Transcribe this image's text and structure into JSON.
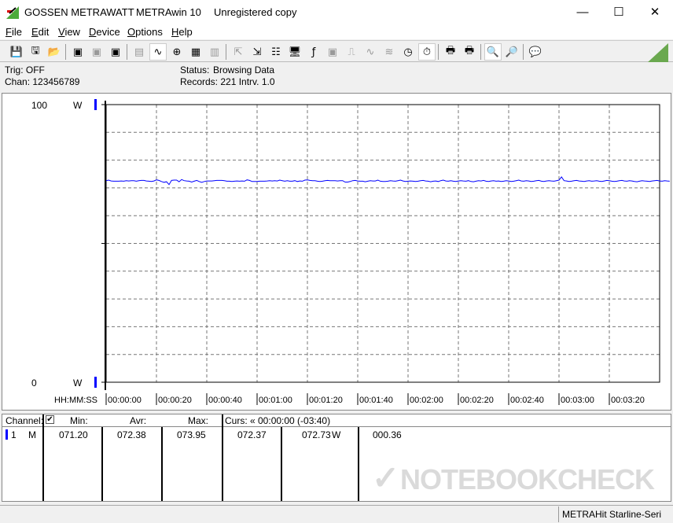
{
  "window": {
    "brand": "GOSSEN METRAWATT",
    "app": "METRAwin 10",
    "license": "Unregistered copy",
    "controls": {
      "minimize": "—",
      "maximize": "☐",
      "close": "✕"
    }
  },
  "menu": [
    "File",
    "Edit",
    "View",
    "Device",
    "Options",
    "Help"
  ],
  "toolbar": [
    {
      "icon": "save-icon",
      "g": "💾"
    },
    {
      "icon": "save-as-icon",
      "g": "🖫"
    },
    {
      "icon": "open-folder-icon",
      "g": "📂"
    },
    "|",
    {
      "icon": "device-read-icon",
      "g": "▣"
    },
    {
      "icon": "device-read-disabled-icon",
      "g": "▣",
      "dis": true
    },
    {
      "icon": "memory-read-icon",
      "g": "▣"
    },
    "|",
    {
      "icon": "numeric-display-icon",
      "g": "▤",
      "dis": true
    },
    {
      "icon": "waveform-view-icon",
      "g": "∿",
      "on": true
    },
    {
      "icon": "crosshair-icon",
      "g": "⊕"
    },
    {
      "icon": "table-view-icon",
      "g": "▦"
    },
    {
      "icon": "bar-view-icon",
      "g": "▥",
      "dis": true
    },
    "|",
    {
      "icon": "export-icon",
      "g": "⇱",
      "dis": true
    },
    {
      "icon": "import-icon",
      "g": "⇲"
    },
    {
      "icon": "settings-list-icon",
      "g": "☷"
    },
    {
      "icon": "monitor-icon",
      "g": "🖥"
    },
    {
      "icon": "function-icon",
      "g": "ƒ"
    },
    {
      "icon": "device-icon",
      "g": "▣",
      "dis": true
    },
    {
      "icon": "trigger-icon",
      "g": "⎍",
      "dis": true
    },
    {
      "icon": "signal-icon",
      "g": "∿",
      "dis": true
    },
    {
      "icon": "wave-icon",
      "g": "≋",
      "dis": true
    },
    {
      "icon": "clock-icon",
      "g": "◷"
    },
    {
      "icon": "timer-icon",
      "g": "⏱",
      "on": true
    },
    "|",
    {
      "icon": "print-preview-icon",
      "g": "🖶"
    },
    {
      "icon": "print-icon",
      "g": "🖶"
    },
    "|",
    {
      "icon": "zoom-waveform-icon",
      "g": "🔍",
      "on": true
    },
    {
      "icon": "zoom-signal-icon",
      "g": "🔎"
    },
    "|",
    {
      "icon": "comment-icon",
      "g": "💬"
    }
  ],
  "info": {
    "trig": "Trig: OFF",
    "chan": "Chan:  123456789",
    "status_label": "Status:",
    "status": "Browsing Data",
    "records": "Records: 221   Intrv. 1.0"
  },
  "chart_data": {
    "type": "line",
    "xlabel": "HH:MM:SS",
    "ylabel": "W",
    "ylim": [
      0,
      100
    ],
    "y_ticks": [
      "100",
      "0"
    ],
    "y_unit": "W",
    "xlim": [
      0,
      220
    ],
    "x_ticks": [
      "00:00:00",
      "00:00:20",
      "00:00:40",
      "00:01:00",
      "00:01:20",
      "00:01:40",
      "00:02:00",
      "00:02:20",
      "00:02:40",
      "00:03:00",
      "00:03:20"
    ],
    "grid": true,
    "color": "#0000ff",
    "values": [
      72.6,
      72.8,
      72.5,
      72.4,
      72.4,
      72.4,
      72.5,
      72.4,
      72.6,
      72.5,
      72.6,
      72.6,
      72.4,
      72.6,
      72.7,
      72.7,
      72.5,
      72.4,
      72.3,
      72.5,
      72.9,
      72.7,
      72.3,
      72.0,
      72.2,
      71.2,
      72.7,
      72.8,
      72.8,
      72.2,
      73.0,
      72.6,
      72.5,
      72.4,
      72.1,
      72.4,
      72.7,
      72.3,
      72.0,
      72.3,
      72.5,
      72.5,
      72.5,
      72.6,
      72.7,
      72.7,
      72.7,
      72.6,
      72.4,
      72.4,
      72.3,
      72.4,
      72.5,
      72.4,
      72.5,
      72.4,
      72.9,
      72.7,
      72.3,
      72.3,
      72.3,
      72.4,
      72.4,
      72.4,
      72.5,
      72.6,
      72.5,
      72.6,
      72.5,
      72.8,
      72.6,
      72.4,
      72.6,
      72.4,
      72.4,
      72.6,
      72.3,
      72.5,
      72.4,
      72.8,
      72.9,
      72.7,
      72.6,
      72.6,
      72.4,
      72.3,
      72.4,
      72.6,
      72.7,
      72.6,
      72.6,
      72.6,
      72.5,
      72.6,
      72.6,
      72.1,
      72.1,
      72.3,
      72.6,
      72.7,
      72.5,
      72.4,
      72.4,
      72.2,
      72.4,
      72.6,
      72.5,
      72.5,
      72.8,
      72.4,
      72.3,
      72.3,
      72.4,
      72.6,
      72.5,
      72.4,
      72.6,
      72.8,
      72.5,
      72.3,
      72.4,
      72.5,
      72.4,
      72.3,
      72.4,
      72.6,
      72.7,
      72.5,
      72.4,
      72.2,
      72.4,
      72.5,
      72.3,
      72.6,
      72.8,
      72.5,
      72.4,
      72.6,
      72.4,
      72.3,
      72.5,
      72.6,
      72.5,
      72.4,
      72.6,
      72.3,
      72.2,
      72.4,
      72.6,
      72.5,
      72.7,
      72.4,
      72.3,
      72.5,
      72.6,
      72.4,
      72.5,
      72.3,
      72.4,
      72.6,
      72.5,
      72.3,
      72.4,
      72.6,
      72.8,
      72.5,
      72.4,
      72.6,
      72.5,
      72.3,
      72.4,
      72.6,
      72.7,
      72.4,
      72.3,
      72.5,
      72.6,
      72.5,
      72.4,
      72.6,
      72.8,
      73.95,
      72.6,
      72.5,
      72.3,
      72.4,
      72.6,
      72.7,
      72.5,
      72.4,
      72.3,
      72.5,
      72.6,
      72.4,
      72.5,
      72.6,
      72.4,
      72.3,
      72.5,
      72.7,
      72.6,
      72.4,
      72.3,
      72.4,
      72.6,
      72.7,
      72.5,
      72.4,
      72.6,
      72.5,
      72.3,
      72.2,
      72.4,
      72.6,
      72.5,
      72.4,
      72.3,
      72.5,
      72.6,
      72.7,
      72.5,
      72.4,
      72.6,
      72.5,
      72.4
    ]
  },
  "table": {
    "headers": {
      "channel": "Channel:",
      "check": "✔",
      "min": "Min:",
      "avr": "Avr:",
      "max": "Max:",
      "curs": "Curs: « 00:00:00 (-03:40)"
    },
    "row": {
      "ch": "1",
      "mode": "M",
      "min": "071.20",
      "avr": "072.38",
      "max": "073.95",
      "c1": "072.37",
      "c2": "072.73",
      "unit": "W",
      "c3": "000.36"
    }
  },
  "watermark": "NOTEBOOKCHECK",
  "statusbar": {
    "device": "METRAHit Starline-Seri"
  }
}
